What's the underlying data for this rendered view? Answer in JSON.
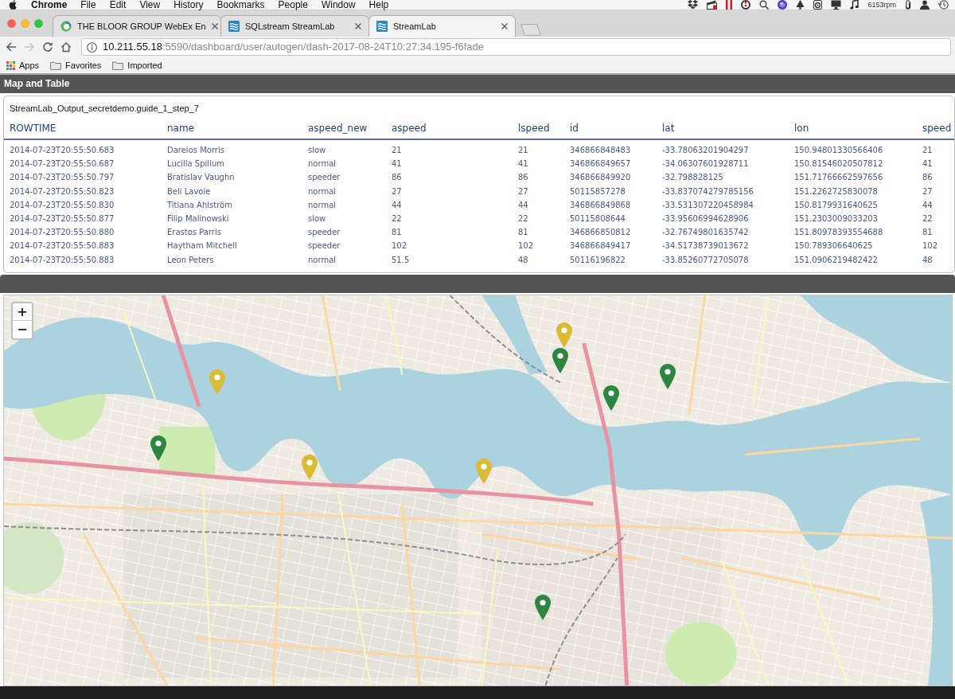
{
  "menu_bar": {
    "app": "Chrome",
    "menus": [
      "File",
      "Edit",
      "View",
      "History",
      "Bookmarks",
      "People",
      "Window",
      "Help"
    ],
    "status_text": "6153rpm"
  },
  "browser": {
    "tabs": [
      {
        "title": "THE BLOOR GROUP WebEx En",
        "kind": "ring",
        "selected": false
      },
      {
        "title": "SQLstream StreamLab",
        "kind": "waves",
        "selected": false
      },
      {
        "title": "StreamLab",
        "kind": "waves",
        "selected": true
      }
    ],
    "nav": [
      {
        "kind": "back",
        "disabled": false
      },
      {
        "kind": "forward",
        "disabled": true
      },
      {
        "kind": "reload",
        "disabled": false
      },
      {
        "kind": "home",
        "disabled": false
      }
    ],
    "address": {
      "host": "10.211.55.18",
      "path": ":5590/dashboard/user/autogen/dash-2017-08-24T10:27:34.195-f6fade"
    },
    "bookmarks": [
      {
        "label": "Apps",
        "kind": "apps"
      },
      {
        "label": "Favorites",
        "kind": "folder"
      },
      {
        "label": "Imported",
        "kind": "folder"
      }
    ]
  },
  "page": {
    "title": "Map and Table",
    "table": {
      "caption": "StreamLab_Output_secretdemo.guide_1_step_7",
      "columns": [
        "ROWTIME",
        "name",
        "aspeed_new",
        "aspeed",
        "lspeed",
        "id",
        "lat",
        "lon",
        "speed"
      ],
      "rows": [
        [
          "2014-07-23T20:55:50.683",
          "Dareios Morris",
          "slow",
          "21",
          "21",
          "346866848483",
          "-33.78063201904297",
          "150.94801330566406",
          "21"
        ],
        [
          "2014-07-23T20:55:50.687",
          "Lucilla Spillum",
          "normal",
          "41",
          "41",
          "346866849657",
          "-34.06307601928711",
          "150.81546020507812",
          "41"
        ],
        [
          "2014-07-23T20:55:50.797",
          "Bratislav Vaughn",
          "speeder",
          "86",
          "86",
          "346866849920",
          "-32.798828125",
          "151.71766662597656",
          "86"
        ],
        [
          "2014-07-23T20:55:50.823",
          "Beli Lavoie",
          "normal",
          "27",
          "27",
          "50115857278",
          "-33.837074279785156",
          "151.2262725830078",
          "27"
        ],
        [
          "2014-07-23T20:55:50.830",
          "Titiana Ahlström",
          "normal",
          "44",
          "44",
          "346866849868",
          "-33.531307220458984",
          "150.8179931640625",
          "44"
        ],
        [
          "2014-07-23T20:55:50.877",
          "Filip Malinowski",
          "slow",
          "22",
          "22",
          "50115808644",
          "-33.95606994628906",
          "151.2303009033203",
          "22"
        ],
        [
          "2014-07-23T20:55:50.880",
          "Erastos Parris",
          "speeder",
          "81",
          "81",
          "346866850812",
          "-32.76749801635742",
          "151.80978393554688",
          "81"
        ],
        [
          "2014-07-23T20:55:50.883",
          "Haytham Mitchell",
          "speeder",
          "102",
          "102",
          "346866849417",
          "-34.51738739013672",
          "150.789306640625",
          "102"
        ],
        [
          "2014-07-23T20:55:50.883",
          "Leon Peters",
          "normal",
          "51.5",
          "48",
          "50116196822",
          "-33.85260772705078",
          "151.0906219482422",
          "48"
        ]
      ]
    },
    "map": {
      "zoom_in": "+",
      "zoom_out": "−",
      "markers": [
        {
          "color": "#d9bb35"
        },
        {
          "color": "#2e8540"
        },
        {
          "color": "#2e8540"
        },
        {
          "color": "#d9bb35"
        },
        {
          "color": "#2e8540"
        },
        {
          "color": "#2e8540"
        },
        {
          "color": "#d9bb35"
        },
        {
          "color": "#d9bb35"
        },
        {
          "color": "#2e8540"
        }
      ]
    }
  }
}
